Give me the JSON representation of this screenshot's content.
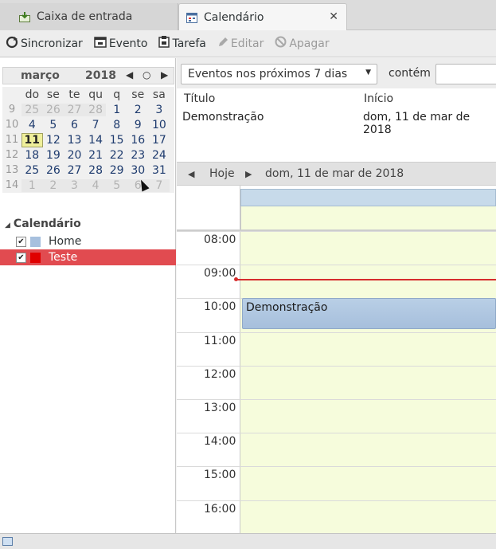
{
  "tabs": {
    "inbox_label": "Caixa de entrada",
    "calendar_label": "Calendário",
    "close_symbol": "✕"
  },
  "toolbar": {
    "sync": "Sincronizar",
    "event": "Evento",
    "task": "Tarefa",
    "edit": "Editar",
    "delete": "Apagar"
  },
  "minical": {
    "month": "março",
    "year": "2018",
    "nav_prev": "◀",
    "nav_today": "○",
    "nav_next": "▶",
    "weekdays": [
      "do",
      "se",
      "te",
      "qu",
      "q",
      "se",
      "sa"
    ],
    "weeks": [
      {
        "wk": "9",
        "days": [
          "25",
          "26",
          "27",
          "28",
          "1",
          "2",
          "3"
        ]
      },
      {
        "wk": "10",
        "days": [
          "4",
          "5",
          "6",
          "7",
          "8",
          "9",
          "10"
        ]
      },
      {
        "wk": "11",
        "days": [
          "11",
          "12",
          "13",
          "14",
          "15",
          "16",
          "17"
        ]
      },
      {
        "wk": "12",
        "days": [
          "18",
          "19",
          "20",
          "21",
          "22",
          "23",
          "24"
        ]
      },
      {
        "wk": "13",
        "days": [
          "25",
          "26",
          "27",
          "28",
          "29",
          "30",
          "31"
        ]
      },
      {
        "wk": "14",
        "days": [
          "1",
          "2",
          "3",
          "4",
          "5",
          "6",
          "7"
        ]
      }
    ],
    "today": "11"
  },
  "calendars": {
    "heading": "Calendário",
    "items": [
      {
        "name": "Home",
        "color": "#a7c0de",
        "checked": true
      },
      {
        "name": "Teste",
        "color": "#e00000",
        "checked": true
      }
    ]
  },
  "filter": {
    "selected": "Eventos nos próximos 7 dias",
    "contains_label": "contém",
    "search_value": ""
  },
  "event_list": {
    "col_title": "Título",
    "col_start": "Início",
    "rows": [
      {
        "title": "Demonstração",
        "start": "dom, 11 de mar de 2018"
      }
    ]
  },
  "day_nav": {
    "prev": "◀",
    "today": "Hoje",
    "next": "▶",
    "date": "dom, 11 de mar de 2018"
  },
  "day_view": {
    "hours": [
      "08:00",
      "09:00",
      "10:00",
      "11:00",
      "12:00",
      "13:00",
      "14:00",
      "15:00",
      "16:00"
    ],
    "event_title": "Demonstração"
  }
}
